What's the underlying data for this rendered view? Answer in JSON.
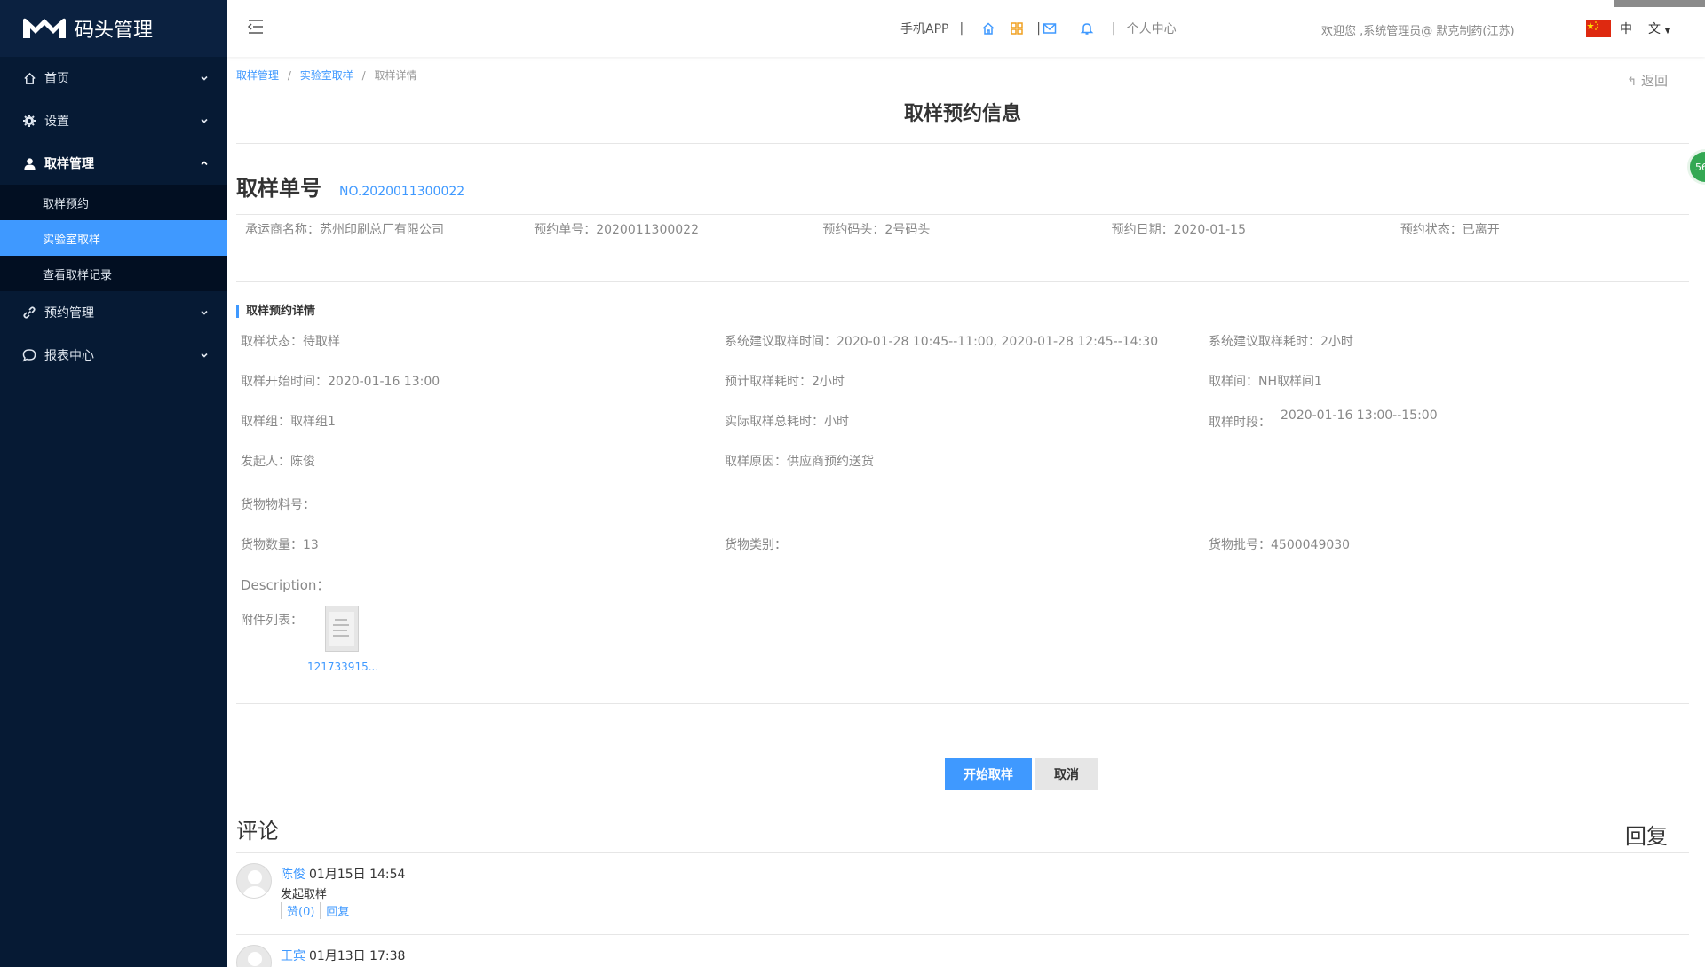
{
  "app": {
    "logo_text": "码头管理"
  },
  "sidebar": {
    "items": [
      {
        "label": "首页",
        "icon": "home-icon"
      },
      {
        "label": "设置",
        "icon": "gear-icon"
      },
      {
        "label": "取样管理",
        "icon": "user-icon"
      },
      {
        "label": "预约管理",
        "icon": "link-icon"
      },
      {
        "label": "报表中心",
        "icon": "chat-icon"
      }
    ],
    "sub_items": [
      "取样预约",
      "实验室取样",
      "查看取样记录"
    ]
  },
  "topbar": {
    "mobile_app": "手机APP",
    "separator": "|",
    "personal_center": "个人中心",
    "welcome": "欢迎您 ,系统管理员@ 默克制药(江苏)",
    "lang_cn": "中",
    "lang_text": "文"
  },
  "breadcrumb": {
    "item1": "取样管理",
    "item2": "实验室取样",
    "item3": "取样详情",
    "slash": "/"
  },
  "back": "返回",
  "page_title": "取样预约信息",
  "order": {
    "title": "取样单号",
    "number": "NO.2020011300022",
    "carrier": "承运商名称：苏州印刷总厂有限公司",
    "reservation_no": "预约单号：2020011300022",
    "dock": "预约码头：2号码头",
    "date": "预约日期：2020-01-15",
    "status": "预约状态：已离开"
  },
  "section_title": "取样预约详情",
  "details": {
    "sampling_status": "取样状态：待取样",
    "suggested_time": "系统建议取样时间：2020-01-28 10:45--11:00, 2020-01-28 12:45--14:30",
    "suggested_duration": "系统建议取样耗时：2小时",
    "start_time": "取样开始时间：2020-01-16 13:00",
    "expected_duration": "预计取样耗时：2小时",
    "room": "取样间：NH取样间1",
    "group": "取样组：取样组1",
    "actual_duration": "实际取样总耗时：小时",
    "period_label": "取样时段：",
    "period_value": "2020-01-16 13:00--15:00",
    "initiator": "发起人：陈俊",
    "reason": "取样原因：供应商预约送货",
    "material_no": "货物物料号：",
    "quantity": "货物数量：13",
    "category": "货物类别：",
    "batch": "货物批号：4500049030",
    "description": "Description：",
    "attachments": "附件列表：",
    "attachment_name": "121733915..."
  },
  "buttons": {
    "start": "开始取样",
    "cancel": "取消"
  },
  "comments": {
    "title": "评论",
    "reply": "回复",
    "list": [
      {
        "author": "陈俊",
        "time": "01月15日 14:54",
        "text": "发起取样",
        "like": "赞(0)",
        "reply": "回复"
      },
      {
        "author": "王宾",
        "time": "01月13日 17:38"
      }
    ]
  },
  "float_badge": "56",
  "colors": {
    "sidebar_bg": "#061a34",
    "accent": "#3f99ff",
    "active_item": "#3f99ff"
  }
}
